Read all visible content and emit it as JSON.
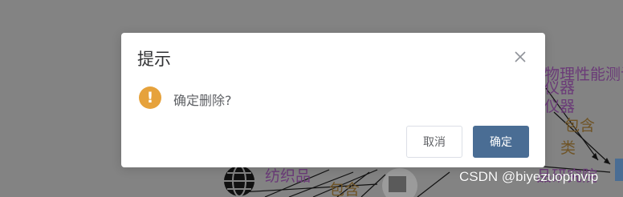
{
  "dialog": {
    "title": "提示",
    "message": "确定删除?",
    "cancel_label": "取消",
    "confirm_label": "确定",
    "warning_glyph": "!",
    "close_icon": "close-icon",
    "status_icon": "warning-icon",
    "accent_color": "#e6a23c",
    "confirm_color": "#4a6d94"
  },
  "background_labels": {
    "label_1": "物理性能测试",
    "label_2": "仪器",
    "label_3": "仪器",
    "label_4": "包含",
    "label_5": "类",
    "label_6": "纺织品",
    "label_7": "品研究院",
    "label_8": "包含"
  },
  "watermark": "CSDN @biyezuopinvip",
  "overlay_color": "#838383"
}
